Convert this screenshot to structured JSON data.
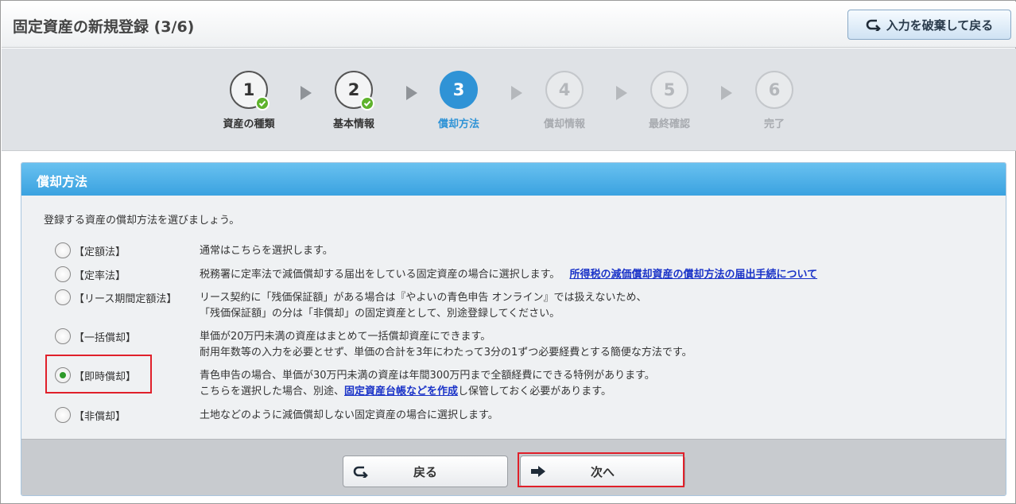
{
  "header": {
    "title": "固定資産の新規登録 (3/6)",
    "discard_label": "入力を破棄して戻る"
  },
  "stepper": {
    "steps": [
      {
        "number": "1",
        "label": "資産の種類",
        "state": "done"
      },
      {
        "number": "2",
        "label": "基本情報",
        "state": "done"
      },
      {
        "number": "3",
        "label": "償却方法",
        "state": "active"
      },
      {
        "number": "4",
        "label": "償却情報",
        "state": "todo"
      },
      {
        "number": "5",
        "label": "最終確認",
        "state": "todo"
      },
      {
        "number": "6",
        "label": "完了",
        "state": "todo"
      }
    ]
  },
  "panel": {
    "title": "償却方法",
    "intro": "登録する資産の償却方法を選びましょう。",
    "options": [
      {
        "name": "【定額法】",
        "desc1": "通常はこちらを選択します。",
        "checked": false
      },
      {
        "name": "【定率法】",
        "desc1": "税務署に定率法で減価償却する届出をしている固定資産の場合に選択します。",
        "link": "所得税の減価償却資産の償却方法の届出手続について",
        "checked": false
      },
      {
        "name": "【リース期間定額法】",
        "desc1": "リース契約に「残価保証額」がある場合は『やよいの青色申告 オンライン』では扱えないため、",
        "desc2": "「残価保証額」の分は「非償却」の固定資産として、別途登録してください。",
        "checked": false
      },
      {
        "name": "【一括償却】",
        "desc1": "単価が20万円未満の資産はまとめて一括償却資産にできます。",
        "desc2": "耐用年数等の入力を必要とせず、単価の合計を3年にわたって3分の1ずつ必要経費とする簡便な方法です。",
        "checked": false
      },
      {
        "name": "【即時償却】",
        "desc1": "青色申告の場合、単価が30万円未満の資産は年間300万円まで全額経費にできる特例があります。",
        "desc2_pre": "こちらを選択した場合、別途、",
        "desc2_link": "固定資産台帳などを作成",
        "desc2_post": "し保管しておく必要があります。",
        "checked": true
      },
      {
        "name": "【非償却】",
        "desc1": "土地などのように減価償却しない固定資産の場合に選択します。",
        "checked": false
      }
    ]
  },
  "footer": {
    "back_label": "戻る",
    "next_label": "次へ"
  },
  "colors": {
    "accent": "#2f93d6",
    "check": "#5fb32d",
    "highlight": "#e0202a",
    "link": "#1a33c8"
  }
}
